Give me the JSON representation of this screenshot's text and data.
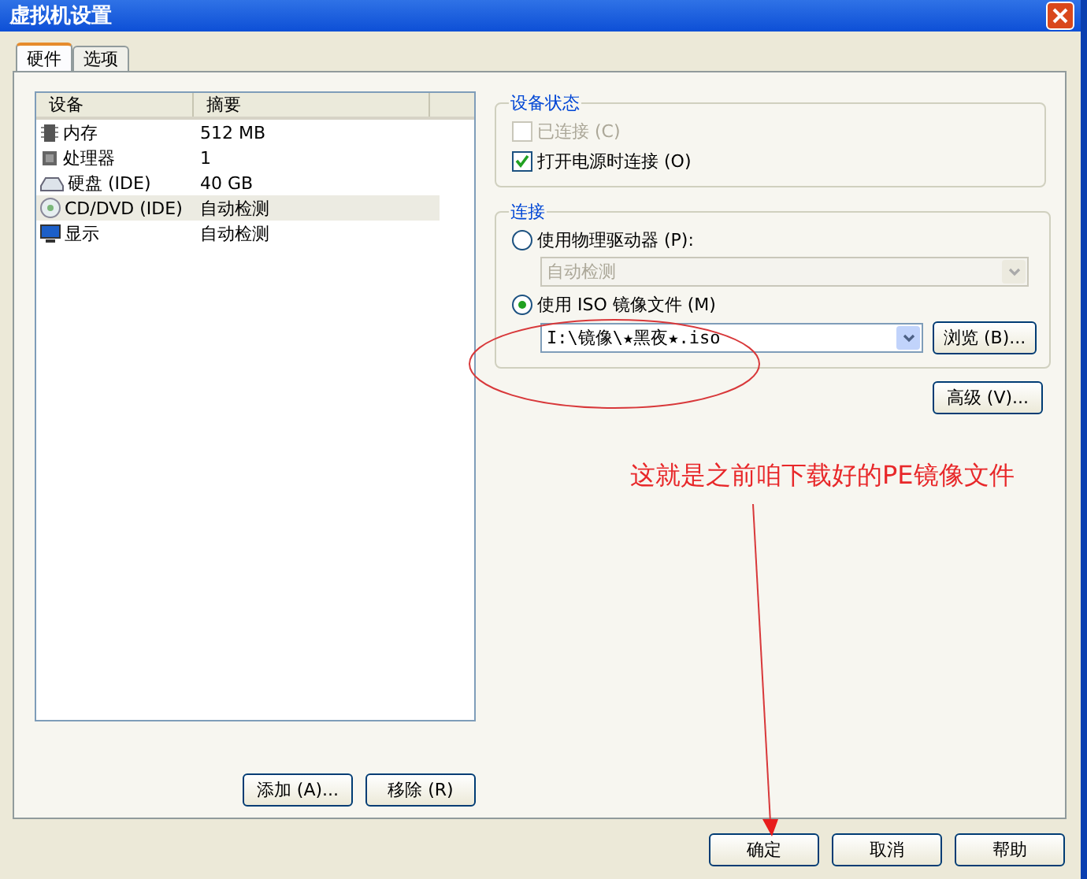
{
  "window": {
    "title": "虚拟机设置"
  },
  "tabs": [
    {
      "label": "硬件",
      "selected": true
    },
    {
      "label": "选项",
      "selected": false
    }
  ],
  "device_list": {
    "columns": [
      "设备",
      "摘要"
    ],
    "rows": [
      {
        "kind": "memory",
        "device": "内存",
        "summary": "512 MB",
        "selected": false
      },
      {
        "kind": "cpu",
        "device": "处理器",
        "summary": "1",
        "selected": false
      },
      {
        "kind": "disk",
        "device": "硬盘 (IDE)",
        "summary": "40 GB",
        "selected": false
      },
      {
        "kind": "cd",
        "device": "CD/DVD (IDE)",
        "summary": "自动检测",
        "selected": true
      },
      {
        "kind": "display",
        "device": "显示",
        "summary": "自动检测",
        "selected": false
      }
    ]
  },
  "list_buttons": [
    "添加 (A)...",
    "移除 (R)"
  ],
  "device_status": {
    "title": "设备状态",
    "items": [
      {
        "label": "已连接 (C)",
        "checked": false,
        "disabled": true
      },
      {
        "label": "打开电源时连接 (O)",
        "checked": true,
        "disabled": false
      }
    ]
  },
  "connection": {
    "title": "连接",
    "physical": {
      "label": "使用物理驱动器 (P):",
      "selected": false,
      "value": "自动检测",
      "disabled": true
    },
    "iso": {
      "label": "使用 ISO 镜像文件 (M)",
      "selected": true,
      "value": "I:\\镜像\\★黑夜★.iso",
      "browse": "浏览 (B)..."
    }
  },
  "advanced_button": "高级 (V)...",
  "annotation": "这就是之前咱下载好的PE镜像文件",
  "dialog_buttons": [
    "确定",
    "取消",
    "帮助"
  ]
}
